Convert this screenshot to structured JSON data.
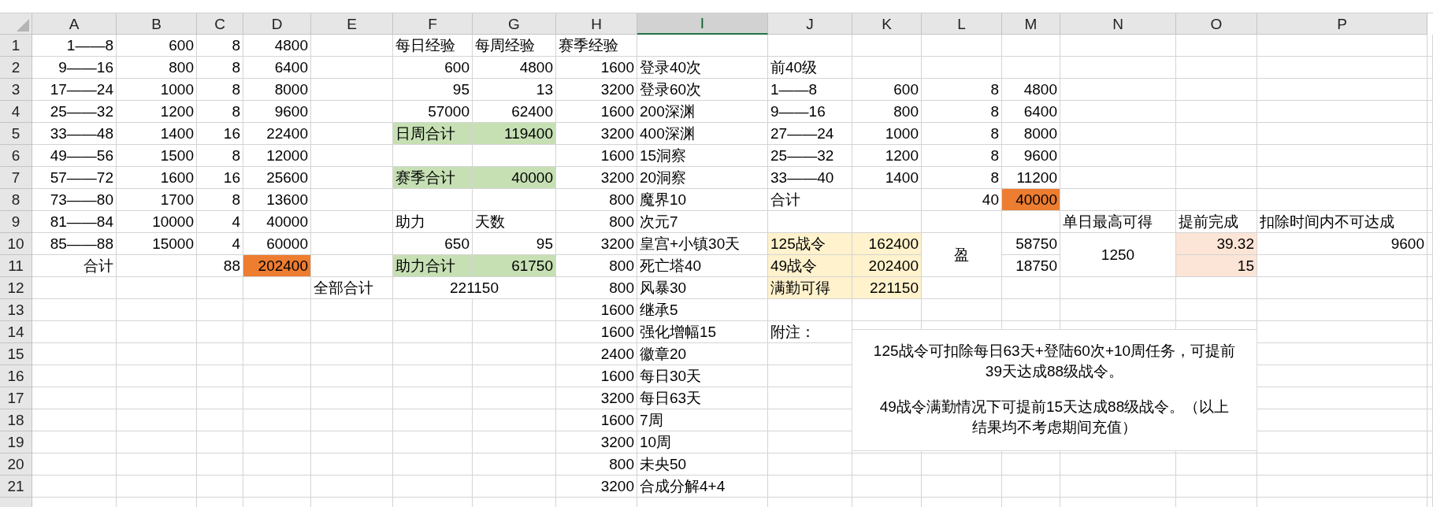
{
  "columns": [
    {
      "label": "A",
      "selected": false
    },
    {
      "label": "B",
      "selected": false
    },
    {
      "label": "C",
      "selected": false
    },
    {
      "label": "D",
      "selected": false
    },
    {
      "label": "E",
      "selected": false
    },
    {
      "label": "F",
      "selected": false
    },
    {
      "label": "G",
      "selected": false
    },
    {
      "label": "H",
      "selected": false
    },
    {
      "label": "I",
      "selected": true
    },
    {
      "label": "J",
      "selected": false
    },
    {
      "label": "K",
      "selected": false
    },
    {
      "label": "L",
      "selected": false
    },
    {
      "label": "M",
      "selected": false
    },
    {
      "label": "N",
      "selected": false
    },
    {
      "label": "O",
      "selected": false
    },
    {
      "label": "P",
      "selected": false
    }
  ],
  "rows": [
    {
      "label": "1",
      "cells": {
        "A": {
          "text": "1——8",
          "kind": "right-text"
        },
        "B": {
          "text": "600",
          "kind": "number"
        },
        "C": {
          "text": "8",
          "kind": "number"
        },
        "D": {
          "text": "4800",
          "kind": "number"
        },
        "F": {
          "text": "每日经验",
          "kind": "text"
        },
        "G": {
          "text": "每周经验",
          "kind": "text"
        },
        "H": {
          "text": "赛季经验",
          "kind": "text"
        }
      }
    },
    {
      "label": "2",
      "cells": {
        "A": {
          "text": "9——16",
          "kind": "right-text"
        },
        "B": {
          "text": "800",
          "kind": "number"
        },
        "C": {
          "text": "8",
          "kind": "number"
        },
        "D": {
          "text": "6400",
          "kind": "number"
        },
        "F": {
          "text": "600",
          "kind": "number"
        },
        "G": {
          "text": "4800",
          "kind": "number"
        },
        "H": {
          "text": "1600",
          "kind": "number"
        },
        "I": {
          "text": "登录40次",
          "kind": "text"
        },
        "J": {
          "text": "前40级",
          "kind": "text"
        }
      }
    },
    {
      "label": "3",
      "cells": {
        "A": {
          "text": "17——24",
          "kind": "right-text"
        },
        "B": {
          "text": "1000",
          "kind": "number"
        },
        "C": {
          "text": "8",
          "kind": "number"
        },
        "D": {
          "text": "8000",
          "kind": "number"
        },
        "F": {
          "text": "95",
          "kind": "number"
        },
        "G": {
          "text": "13",
          "kind": "number"
        },
        "H": {
          "text": "3200",
          "kind": "number"
        },
        "I": {
          "text": "登录60次",
          "kind": "text"
        },
        "J": {
          "text": "1——8",
          "kind": "text"
        },
        "K": {
          "text": "600",
          "kind": "number"
        },
        "L": {
          "text": "8",
          "kind": "number"
        },
        "M": {
          "text": "4800",
          "kind": "number"
        }
      }
    },
    {
      "label": "4",
      "cells": {
        "A": {
          "text": "25——32",
          "kind": "right-text"
        },
        "B": {
          "text": "1200",
          "kind": "number"
        },
        "C": {
          "text": "8",
          "kind": "number"
        },
        "D": {
          "text": "9600",
          "kind": "number"
        },
        "F": {
          "text": "57000",
          "kind": "number"
        },
        "G": {
          "text": "62400",
          "kind": "number"
        },
        "H": {
          "text": "1600",
          "kind": "number"
        },
        "I": {
          "text": "200深渊",
          "kind": "text"
        },
        "J": {
          "text": "9——16",
          "kind": "text"
        },
        "K": {
          "text": "800",
          "kind": "number"
        },
        "L": {
          "text": "8",
          "kind": "number"
        },
        "M": {
          "text": "6400",
          "kind": "number"
        }
      }
    },
    {
      "label": "5",
      "cells": {
        "A": {
          "text": "33——48",
          "kind": "right-text"
        },
        "B": {
          "text": "1400",
          "kind": "number"
        },
        "C": {
          "text": "16",
          "kind": "number"
        },
        "D": {
          "text": "22400",
          "kind": "number"
        },
        "F": {
          "text": "日周合计",
          "kind": "text",
          "color": "#c6e0b4"
        },
        "G": {
          "text": "119400",
          "kind": "number",
          "color": "#c6e0b4"
        },
        "H": {
          "text": "3200",
          "kind": "number"
        },
        "I": {
          "text": "400深渊",
          "kind": "text"
        },
        "J": {
          "text": "27——24",
          "kind": "text"
        },
        "K": {
          "text": "1000",
          "kind": "number"
        },
        "L": {
          "text": "8",
          "kind": "number"
        },
        "M": {
          "text": "8000",
          "kind": "number"
        }
      }
    },
    {
      "label": "6",
      "cells": {
        "A": {
          "text": "49——56",
          "kind": "right-text"
        },
        "B": {
          "text": "1500",
          "kind": "number"
        },
        "C": {
          "text": "8",
          "kind": "number"
        },
        "D": {
          "text": "12000",
          "kind": "number"
        },
        "H": {
          "text": "1600",
          "kind": "number"
        },
        "I": {
          "text": "15洞察",
          "kind": "text"
        },
        "J": {
          "text": "25——32",
          "kind": "text"
        },
        "K": {
          "text": "1200",
          "kind": "number"
        },
        "L": {
          "text": "8",
          "kind": "number"
        },
        "M": {
          "text": "9600",
          "kind": "number"
        }
      }
    },
    {
      "label": "7",
      "cells": {
        "A": {
          "text": "57——72",
          "kind": "right-text"
        },
        "B": {
          "text": "1600",
          "kind": "number"
        },
        "C": {
          "text": "16",
          "kind": "number"
        },
        "D": {
          "text": "25600",
          "kind": "number"
        },
        "F": {
          "text": "赛季合计",
          "kind": "text",
          "color": "#c6e0b4"
        },
        "G": {
          "text": "40000",
          "kind": "number",
          "color": "#c6e0b4"
        },
        "H": {
          "text": "3200",
          "kind": "number"
        },
        "I": {
          "text": "20洞察",
          "kind": "text"
        },
        "J": {
          "text": "33——40",
          "kind": "text"
        },
        "K": {
          "text": "1400",
          "kind": "number"
        },
        "L": {
          "text": "8",
          "kind": "number"
        },
        "M": {
          "text": "11200",
          "kind": "number"
        }
      }
    },
    {
      "label": "8",
      "cells": {
        "A": {
          "text": "73——80",
          "kind": "right-text"
        },
        "B": {
          "text": "1700",
          "kind": "number"
        },
        "C": {
          "text": "8",
          "kind": "number"
        },
        "D": {
          "text": "13600",
          "kind": "number"
        },
        "H": {
          "text": "800",
          "kind": "number"
        },
        "I": {
          "text": "魔界10",
          "kind": "text"
        },
        "J": {
          "text": "合计",
          "kind": "text"
        },
        "L": {
          "text": "40",
          "kind": "number"
        },
        "M": {
          "text": "40000",
          "kind": "number",
          "color": "#ed7d31"
        }
      }
    },
    {
      "label": "9",
      "cells": {
        "A": {
          "text": "81——84",
          "kind": "right-text"
        },
        "B": {
          "text": "10000",
          "kind": "number"
        },
        "C": {
          "text": "4",
          "kind": "number"
        },
        "D": {
          "text": "40000",
          "kind": "number"
        },
        "F": {
          "text": "助力",
          "kind": "text"
        },
        "G": {
          "text": "天数",
          "kind": "text"
        },
        "H": {
          "text": "800",
          "kind": "number"
        },
        "I": {
          "text": "次元7",
          "kind": "text"
        },
        "N": {
          "text": "单日最高可得",
          "kind": "text"
        },
        "O": {
          "text": "提前完成",
          "kind": "text"
        },
        "P": {
          "text": "扣除时间内不可达成",
          "kind": "text"
        }
      }
    },
    {
      "label": "10",
      "cells": {
        "A": {
          "text": "85——88",
          "kind": "right-text"
        },
        "B": {
          "text": "15000",
          "kind": "number"
        },
        "C": {
          "text": "4",
          "kind": "number"
        },
        "D": {
          "text": "60000",
          "kind": "number"
        },
        "F": {
          "text": "650",
          "kind": "number"
        },
        "G": {
          "text": "95",
          "kind": "number"
        },
        "H": {
          "text": "3200",
          "kind": "number"
        },
        "I": {
          "text": "皇宫+小镇30天",
          "kind": "text"
        },
        "J": {
          "text": "125战令",
          "kind": "text",
          "color": "#fff2cc"
        },
        "K": {
          "text": "162400",
          "kind": "number",
          "color": "#fff2cc"
        },
        "L": {
          "text": "盈",
          "kind": "center",
          "merged_down": true
        },
        "M": {
          "text": "58750",
          "kind": "number"
        },
        "N": {
          "text": "1250",
          "kind": "center",
          "merged_down": true
        },
        "O": {
          "text": "39.32",
          "kind": "number",
          "color": "#fce4d6"
        },
        "P": {
          "text": "9600",
          "kind": "number"
        }
      }
    },
    {
      "label": "11",
      "cells": {
        "A": {
          "text": "合计",
          "kind": "right-text"
        },
        "C": {
          "text": "88",
          "kind": "number"
        },
        "D": {
          "text": "202400",
          "kind": "number",
          "color": "#ed7d31"
        },
        "F": {
          "text": "助力合计",
          "kind": "text",
          "color": "#c6e0b4"
        },
        "G": {
          "text": "61750",
          "kind": "number",
          "color": "#c6e0b4"
        },
        "H": {
          "text": "800",
          "kind": "number"
        },
        "I": {
          "text": "死亡塔40",
          "kind": "text"
        },
        "J": {
          "text": "49战令",
          "kind": "text",
          "color": "#fff2cc"
        },
        "K": {
          "text": "202400",
          "kind": "number",
          "color": "#fff2cc"
        },
        "M": {
          "text": "18750",
          "kind": "number"
        },
        "O": {
          "text": "15",
          "kind": "number",
          "color": "#fce4d6"
        }
      }
    },
    {
      "label": "12",
      "cells": {
        "E": {
          "text": "全部合计",
          "kind": "text"
        },
        "F": {
          "text": "221150",
          "kind": "center",
          "merged_right": true
        },
        "H": {
          "text": "800",
          "kind": "number"
        },
        "I": {
          "text": "风暴30",
          "kind": "text"
        },
        "J": {
          "text": "满勤可得",
          "kind": "text",
          "color": "#fff2cc"
        },
        "K": {
          "text": "221150",
          "kind": "number",
          "color": "#fff2cc"
        }
      }
    },
    {
      "label": "13",
      "cells": {
        "H": {
          "text": "1600",
          "kind": "number"
        },
        "I": {
          "text": "继承5",
          "kind": "text"
        }
      }
    },
    {
      "label": "14",
      "cells": {
        "H": {
          "text": "1600",
          "kind": "number"
        },
        "I": {
          "text": "强化增幅15",
          "kind": "text"
        },
        "J": {
          "text": "附注：",
          "kind": "text"
        }
      }
    },
    {
      "label": "15",
      "cells": {
        "H": {
          "text": "2400",
          "kind": "number"
        },
        "I": {
          "text": "徽章20",
          "kind": "text"
        }
      }
    },
    {
      "label": "16",
      "cells": {
        "H": {
          "text": "1600",
          "kind": "number"
        },
        "I": {
          "text": "每日30天",
          "kind": "text"
        }
      }
    },
    {
      "label": "17",
      "cells": {
        "H": {
          "text": "3200",
          "kind": "number"
        },
        "I": {
          "text": "每日63天",
          "kind": "text"
        }
      }
    },
    {
      "label": "18",
      "cells": {
        "H": {
          "text": "1600",
          "kind": "number"
        },
        "I": {
          "text": "7周",
          "kind": "text"
        }
      }
    },
    {
      "label": "19",
      "cells": {
        "H": {
          "text": "3200",
          "kind": "number"
        },
        "I": {
          "text": "10周",
          "kind": "text"
        }
      }
    },
    {
      "label": "20",
      "cells": {
        "H": {
          "text": "800",
          "kind": "number"
        },
        "I": {
          "text": "未央50",
          "kind": "text"
        }
      }
    },
    {
      "label": "21",
      "cells": {
        "H": {
          "text": "3200",
          "kind": "number"
        },
        "I": {
          "text": "合成分解4+4",
          "kind": "text"
        }
      }
    }
  ],
  "note_box": {
    "paragraphs": [
      "125战令可扣除每日63天+登陆60次+10周任务，可提前39天达成88级战令。",
      "49战令满勤情况下可提前15天达成88级战令。（以上结果均不考虑期间充值）"
    ]
  }
}
